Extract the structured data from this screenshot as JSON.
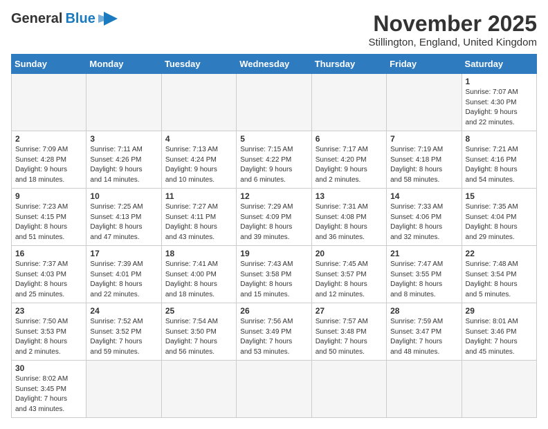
{
  "header": {
    "logo_general": "General",
    "logo_blue": "Blue",
    "month_title": "November 2025",
    "location": "Stillington, England, United Kingdom"
  },
  "weekdays": [
    "Sunday",
    "Monday",
    "Tuesday",
    "Wednesday",
    "Thursday",
    "Friday",
    "Saturday"
  ],
  "weeks": [
    [
      {
        "day": "",
        "info": ""
      },
      {
        "day": "",
        "info": ""
      },
      {
        "day": "",
        "info": ""
      },
      {
        "day": "",
        "info": ""
      },
      {
        "day": "",
        "info": ""
      },
      {
        "day": "",
        "info": ""
      },
      {
        "day": "1",
        "info": "Sunrise: 7:07 AM\nSunset: 4:30 PM\nDaylight: 9 hours\nand 22 minutes."
      }
    ],
    [
      {
        "day": "2",
        "info": "Sunrise: 7:09 AM\nSunset: 4:28 PM\nDaylight: 9 hours\nand 18 minutes."
      },
      {
        "day": "3",
        "info": "Sunrise: 7:11 AM\nSunset: 4:26 PM\nDaylight: 9 hours\nand 14 minutes."
      },
      {
        "day": "4",
        "info": "Sunrise: 7:13 AM\nSunset: 4:24 PM\nDaylight: 9 hours\nand 10 minutes."
      },
      {
        "day": "5",
        "info": "Sunrise: 7:15 AM\nSunset: 4:22 PM\nDaylight: 9 hours\nand 6 minutes."
      },
      {
        "day": "6",
        "info": "Sunrise: 7:17 AM\nSunset: 4:20 PM\nDaylight: 9 hours\nand 2 minutes."
      },
      {
        "day": "7",
        "info": "Sunrise: 7:19 AM\nSunset: 4:18 PM\nDaylight: 8 hours\nand 58 minutes."
      },
      {
        "day": "8",
        "info": "Sunrise: 7:21 AM\nSunset: 4:16 PM\nDaylight: 8 hours\nand 54 minutes."
      }
    ],
    [
      {
        "day": "9",
        "info": "Sunrise: 7:23 AM\nSunset: 4:15 PM\nDaylight: 8 hours\nand 51 minutes."
      },
      {
        "day": "10",
        "info": "Sunrise: 7:25 AM\nSunset: 4:13 PM\nDaylight: 8 hours\nand 47 minutes."
      },
      {
        "day": "11",
        "info": "Sunrise: 7:27 AM\nSunset: 4:11 PM\nDaylight: 8 hours\nand 43 minutes."
      },
      {
        "day": "12",
        "info": "Sunrise: 7:29 AM\nSunset: 4:09 PM\nDaylight: 8 hours\nand 39 minutes."
      },
      {
        "day": "13",
        "info": "Sunrise: 7:31 AM\nSunset: 4:08 PM\nDaylight: 8 hours\nand 36 minutes."
      },
      {
        "day": "14",
        "info": "Sunrise: 7:33 AM\nSunset: 4:06 PM\nDaylight: 8 hours\nand 32 minutes."
      },
      {
        "day": "15",
        "info": "Sunrise: 7:35 AM\nSunset: 4:04 PM\nDaylight: 8 hours\nand 29 minutes."
      }
    ],
    [
      {
        "day": "16",
        "info": "Sunrise: 7:37 AM\nSunset: 4:03 PM\nDaylight: 8 hours\nand 25 minutes."
      },
      {
        "day": "17",
        "info": "Sunrise: 7:39 AM\nSunset: 4:01 PM\nDaylight: 8 hours\nand 22 minutes."
      },
      {
        "day": "18",
        "info": "Sunrise: 7:41 AM\nSunset: 4:00 PM\nDaylight: 8 hours\nand 18 minutes."
      },
      {
        "day": "19",
        "info": "Sunrise: 7:43 AM\nSunset: 3:58 PM\nDaylight: 8 hours\nand 15 minutes."
      },
      {
        "day": "20",
        "info": "Sunrise: 7:45 AM\nSunset: 3:57 PM\nDaylight: 8 hours\nand 12 minutes."
      },
      {
        "day": "21",
        "info": "Sunrise: 7:47 AM\nSunset: 3:55 PM\nDaylight: 8 hours\nand 8 minutes."
      },
      {
        "day": "22",
        "info": "Sunrise: 7:48 AM\nSunset: 3:54 PM\nDaylight: 8 hours\nand 5 minutes."
      }
    ],
    [
      {
        "day": "23",
        "info": "Sunrise: 7:50 AM\nSunset: 3:53 PM\nDaylight: 8 hours\nand 2 minutes."
      },
      {
        "day": "24",
        "info": "Sunrise: 7:52 AM\nSunset: 3:52 PM\nDaylight: 7 hours\nand 59 minutes."
      },
      {
        "day": "25",
        "info": "Sunrise: 7:54 AM\nSunset: 3:50 PM\nDaylight: 7 hours\nand 56 minutes."
      },
      {
        "day": "26",
        "info": "Sunrise: 7:56 AM\nSunset: 3:49 PM\nDaylight: 7 hours\nand 53 minutes."
      },
      {
        "day": "27",
        "info": "Sunrise: 7:57 AM\nSunset: 3:48 PM\nDaylight: 7 hours\nand 50 minutes."
      },
      {
        "day": "28",
        "info": "Sunrise: 7:59 AM\nSunset: 3:47 PM\nDaylight: 7 hours\nand 48 minutes."
      },
      {
        "day": "29",
        "info": "Sunrise: 8:01 AM\nSunset: 3:46 PM\nDaylight: 7 hours\nand 45 minutes."
      }
    ],
    [
      {
        "day": "30",
        "info": "Sunrise: 8:02 AM\nSunset: 3:45 PM\nDaylight: 7 hours\nand 43 minutes."
      },
      {
        "day": "",
        "info": ""
      },
      {
        "day": "",
        "info": ""
      },
      {
        "day": "",
        "info": ""
      },
      {
        "day": "",
        "info": ""
      },
      {
        "day": "",
        "info": ""
      },
      {
        "day": "",
        "info": ""
      }
    ]
  ]
}
